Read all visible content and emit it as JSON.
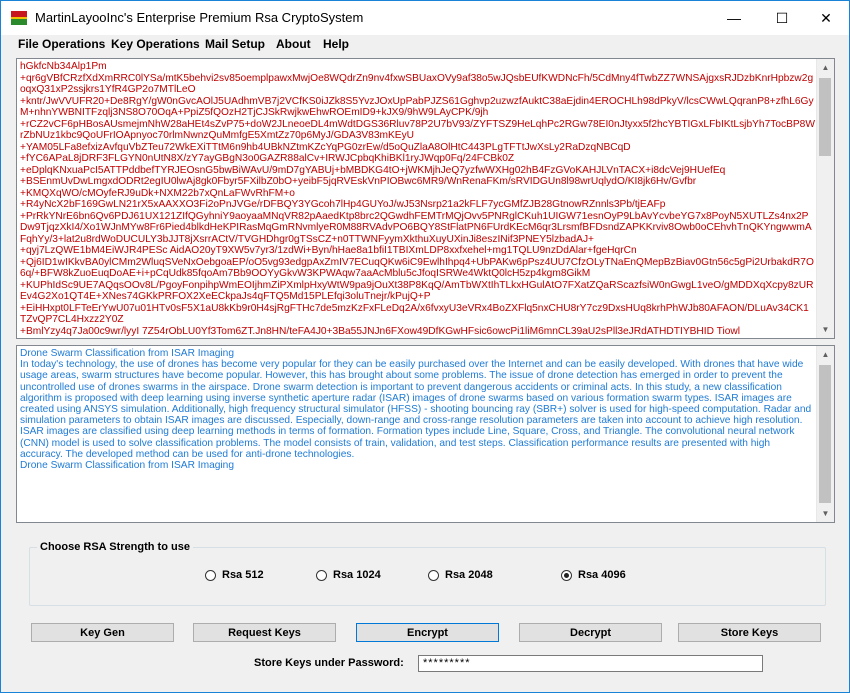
{
  "window": {
    "title": "MartinLayooInc's Enterprise Premium Rsa CryptoSystem",
    "controls": {
      "minimize": "—",
      "maximize": "☐",
      "close": "✕"
    }
  },
  "menu": {
    "items": [
      "File Operations",
      "Key Operations",
      "Mail Setup",
      "About",
      "Help"
    ]
  },
  "ciphertext": {
    "text": "hGkfcNb34Alp1Pm\n+qr6gVBfCRzfXdXmRRC0lYSa/mtK5behvi2sv85oemplpawxMwjOe8WQdrZn9nv4fxwSBUaxOVy9af38o5wJQsbEUfKWDNcFh/5CdMny4fTwbZZ7WNSAjgxsRJDzbKnrHpbzw2goqxQ31xP2ssjkrs1YfR4GP2o7MTlLeO\n+kntr/JwVVUFR20+De8RgY/gW0nGvcAOlJ5UAdhmVB7j2VCfKS0iJZk8S5YvzJOxUpPabPJZS61Gghvp2uzwzfAuktC38aEjdin4EROCHLh98dPkyV/lcsCWwLQqranP8+zfhL6GyM+nhnYWBNITFzqlj3NS8O70OqA+PpiZ5fQOzH2TjCJSkRwjkwEhwROEmID9+kJX9/9hW9LAyCPK/9jh\n+rCZ2vCF6pHBosAUsmejmNhW28aHEt4sZvP75+doW2JLneoeDL4mWdtDGS36Rluv78P2U7bV93/ZYFTSZ9HeLqhPc2RGw78EI0nJtyxx5f2hcYBTIGxLFbIKtLsjbYh7TocBP8WrZbNUz1kbc9QoUFrIOApnyoc70rlmNwnzQuMmfgE5XmtZz70p6MyJ/GDA3V83mKEyU\n+YAM05LFa8efxizAvfquVbZTeu72WkEXiTTtM6n9hb4UBkNZtmKZcYqPG0zrEw/d5oQuZlaA8OlHtC443PLgTFTtJwXsLy2RaDzqNBCqD\n+fYC6APaL8jDRF3FLGYN0nUtN8X/zY7ayGBgN3o0GAZR88alCv+IRWJCpbqKhiBKl1ryJWqp0Fq/24FCBk0Z\n+eDplqKNxuaPcI5ATTPddbefTYRJEOsnG5bwBiWAvU/9mD7gYABUj+bMBDKG4tO+jWKMjhJeQ7yzfwWXHg02hB4FzGVoKAHJLVnTACX+i8dcVej9HUefEq\n+BSEnmUvDwLmgxdODRt2egIU0lwAj8gk0Fbyr5FXilbZ0bO+yeibF5jqRVEskVnPIOBwc6MR9/WnRenaFKm/sRVIDGUn8l98wrUqlydO/KI8jk6Hv/Gvfbr\n+KMQXqWO/cMOyfeRJ9uDk+NXM22b7xQnLaFWvRhFM+o\n+R4yNcX2bF169GwLN21rX5xAAXXO3Fi2oPnJVGe/rDFBQY3YGcoh7lHp4GUYoJ/wJ53Nsrp21a2kFLF7ycGMfZJB28GtnowRZnnls3Pb/tjEAFp\n+PrRkYNrE6bn6Qv6PDJ61UX121ZIfQGyhniY9aoyaaMNqVR82pAaedKtp8brc2QGwdhFEMTrMQjOvv5PNRglCKuh1UIGW71esnOyP9LbAvYcvbeYG7x8PoyN5XUTLZs4nx2PDw9TjqzXkI4/Xo1WJnMYw8Fr6Pied4blkdHeKPIRasMqGmRNvmlyeR0M88RVAdvPO6BQY8StFlatPN6FUrdKEcM6qr3LrsmfBFDsndZAPKKrviv8Owb0oCEhvhTnQKYngwwmAFqhYy/3+lat2u8rdWoDUCULY3bJJT8jXsrrACtV/TVGHDhgr0gTSsCZ+n0TTWNFyymXkthuXuyUXinJi8eszINif3PNEY5lzbadAJ+\n+qyj7LzQWE1bM4EiWJR4PESc AidAO20yT9XW5v7yr3/1zdWi+Byn/hHae8a1bfiI1TBIXmLDP8xxfxehel+mg1TQLU9nzDdAlar+fgeHqrCn\n+Qj6ID1wIKkvBA0ylCMm2WluqSVeNxOebgoaEP/oO5vg93edgpAxZmIV7ECuqQKw6iC9EwlhIhpq4+UbPAKw6pPsz4UU7CfzOLyTNaEnQMepBzBiav0Gtn56c5gPi2UrbakdR7O6q/+BFW8kZuoEuqDoAE+i+pCqUdk85fqoAm7Bb9OOYyGkvW3KPWAqw7aaAcMblu5cJfoqISRWe4WktQ0lcH5zp4kgm8GikM\n+KUPhIdSc9UE7AQqsOOv8L/PgoyFonpihpWmEOIjhmZiPXmlpHxyWtW9pa9jOuXt38P8KqQ/AmTbWXtIhTLkxHGulAtO7FXatZQaRScazfsiW0nGwgL1veO/gMDDXqXcpy8zUREv4G2Xo1QT4E+XNes74GKkPRFOX2XeECkpaJs4qFTQ5Md15PLEfqi3oluTnejr/kPujQ+P\n+EiHHxpt0LFTeErYwU07u01HTv0sF5X1aU8kKb9r0H4sjRgFTHc7de5mzKzFxFLeDq2A/x6fvxyU3eVRx4BoZXFlq5nxCHU8rY7cz9DxsHUq8krhPhWJb80AFAON/DLuAv34CK1TZvQP7CL4Hxzz2Y0Z\n+BmlYzy4q7Ja00c9wr/lyyI 7Z54rObLU0Yf3Tom6ZT.Jn8HN/teFA4J0+3Ba55JNJn6FXow49DfKGwHFsic6owcPi1liM6mnCL39aU2sPll3eJRdATHDTIYBHID Tiowl"
  },
  "plaintext": {
    "title_line": "Drone Swarm Classification from ISAR Imaging",
    "body": "In today's technology, the use of drones has become very popular for they can be easily purchased over the Internet and can be easily developed. With drones that have wide usage areas, swarm structures have become popular. However, this has brought about some problems. The issue of drone detection has emerged in order to prevent the uncontrolled use of drones swarms in the airspace. Drone swarm detection is important to prevent dangerous accidents or criminal acts. In this study, a new classification algorithm is proposed with deep learning using inverse synthetic aperture radar (ISAR) images of drone swarms based on various formation swarm types. ISAR images are created using ANSYS simulation. Additionally, high frequency structural simulator (HFSS) - shooting bouncing ray (SBR+) solver is used for high-speed computation. Radar and simulation parameters to obtain ISAR images are discussed. Especially, down-range and cross-range resolution parameters are taken into account to achieve high resolution. ISAR images are classified using deep learning methods in terms of formation. Formation types include Line, Square, Cross, and Triangle. The convolutional neural network (CNN) model is used to solve classification problems. The model consists of train, validation, and test steps. Classification performance results are presented with high accuracy. The developed method can be used for anti-drone technologies.",
    "footer_line": "Drone Swarm Classification from ISAR Imaging"
  },
  "rsa_strength": {
    "label": "Choose RSA Strength to use",
    "options": [
      {
        "label": "Rsa 512",
        "selected": false
      },
      {
        "label": "Rsa 1024",
        "selected": false
      },
      {
        "label": "Rsa 2048",
        "selected": false
      },
      {
        "label": "Rsa 4096",
        "selected": true
      }
    ]
  },
  "buttons": {
    "key_gen": "Key Gen",
    "request_keys": "Request Keys",
    "encrypt": "Encrypt",
    "decrypt": "Decrypt",
    "store_keys": "Store Keys"
  },
  "password": {
    "label": "Store Keys under Password:",
    "value": "*********"
  },
  "colors": {
    "cipher_text": "#c00000",
    "plain_text": "#1f7bd6",
    "title_accent": "#1883d7"
  }
}
